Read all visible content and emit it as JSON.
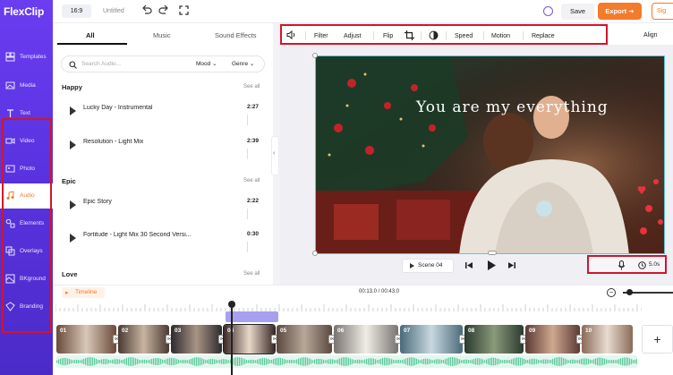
{
  "app": {
    "logo": "FlexClip",
    "ratio": "16:9",
    "title": "Untitled",
    "save": "Save",
    "export": "Export",
    "signin": "Sig"
  },
  "sidebar": {
    "items": [
      {
        "label": "Templates",
        "icon": "templates-icon"
      },
      {
        "label": "Media",
        "icon": "media-icon"
      },
      {
        "label": "Text",
        "icon": "text-icon"
      },
      {
        "label": "Video",
        "icon": "video-icon"
      },
      {
        "label": "Photo",
        "icon": "photo-icon"
      },
      {
        "label": "Audio",
        "icon": "audio-icon",
        "active": true
      },
      {
        "label": "Elements",
        "icon": "elements-icon"
      },
      {
        "label": "Overlays",
        "icon": "overlays-icon"
      },
      {
        "label": "BKground",
        "icon": "background-icon"
      },
      {
        "label": "Branding",
        "icon": "branding-icon"
      }
    ]
  },
  "audio_panel": {
    "tabs": [
      "All",
      "Music",
      "Sound Effects"
    ],
    "search_placeholder": "Search Audio...",
    "filter_mood": "Mood",
    "filter_genre": "Genre",
    "see_all": "See all",
    "sections": [
      {
        "title": "Happy",
        "tracks": [
          {
            "name": "Lucky Day - Instrumental",
            "duration": "2:27"
          },
          {
            "name": "Resolution - Light Mix",
            "duration": "2:39"
          }
        ]
      },
      {
        "title": "Epic",
        "tracks": [
          {
            "name": "Epic Story",
            "duration": "2:22"
          },
          {
            "name": "Fortitude - Light Mix 30 Second Versi...",
            "duration": "0:30"
          }
        ]
      },
      {
        "title": "Love",
        "tracks": []
      }
    ]
  },
  "toolbar": {
    "items": [
      "Filter",
      "Adjust",
      "Flip",
      "Speed",
      "Motion",
      "Replace"
    ],
    "align": "Align"
  },
  "canvas": {
    "caption": "You are my everything"
  },
  "playback": {
    "scene": "Scene 04",
    "duration": "5.0s"
  },
  "timeline": {
    "label": "Timeline",
    "time": "00:13.0 / 00:43.0",
    "clips": [
      "01",
      "02",
      "03",
      "04",
      "05",
      "06",
      "07",
      "08",
      "09",
      "10"
    ],
    "add": "+"
  },
  "colors": {
    "brand_purple": "#5a33e0",
    "accent_orange": "#f27b2c",
    "highlight_red": "#d4142a"
  }
}
